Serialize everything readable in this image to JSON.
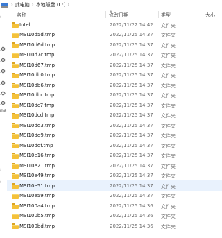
{
  "breadcrumb": {
    "items": [
      "此电脑",
      "本地磁盘 (C:)"
    ],
    "separator": "›"
  },
  "nav": {
    "fragment": "ma",
    "pins": 8
  },
  "columns": {
    "name": "名称",
    "date": "修改日期",
    "type": "类型",
    "size": "大小"
  },
  "hovered_row": 16,
  "rows": [
    {
      "name": "Intel",
      "date": "2022/11/22 14:42",
      "type": "文件夹"
    },
    {
      "name": "MSI10d5d.tmp",
      "date": "2022/11/25 14:37",
      "type": "文件夹"
    },
    {
      "name": "MSI10d6d.tmp",
      "date": "2022/11/25 14:37",
      "type": "文件夹"
    },
    {
      "name": "MSI10d7c.tmp",
      "date": "2022/11/25 14:37",
      "type": "文件夹"
    },
    {
      "name": "MSI10d67.tmp",
      "date": "2022/11/25 14:37",
      "type": "文件夹"
    },
    {
      "name": "MSI10db0.tmp",
      "date": "2022/11/25 14:37",
      "type": "文件夹"
    },
    {
      "name": "MSI10db6.tmp",
      "date": "2022/11/25 14:37",
      "type": "文件夹"
    },
    {
      "name": "MSI10dbc.tmp",
      "date": "2022/11/25 14:37",
      "type": "文件夹"
    },
    {
      "name": "MSI10dc7.tmp",
      "date": "2022/11/25 14:37",
      "type": "文件夹"
    },
    {
      "name": "MSI10dcd.tmp",
      "date": "2022/11/25 14:37",
      "type": "文件夹"
    },
    {
      "name": "MSI10dd3.tmp",
      "date": "2022/11/25 14:37",
      "type": "文件夹"
    },
    {
      "name": "MSI10dd9.tmp",
      "date": "2022/11/25 14:37",
      "type": "文件夹"
    },
    {
      "name": "MSI10ddf.tmp",
      "date": "2022/11/25 14:37",
      "type": "文件夹"
    },
    {
      "name": "MSI10e16.tmp",
      "date": "2022/11/25 14:37",
      "type": "文件夹"
    },
    {
      "name": "MSI10e21.tmp",
      "date": "2022/11/25 14:37",
      "type": "文件夹"
    },
    {
      "name": "MSI10e49.tmp",
      "date": "2022/11/25 14:37",
      "type": "文件夹"
    },
    {
      "name": "MSI10e51.tmp",
      "date": "2022/11/25 14:37",
      "type": "文件夹"
    },
    {
      "name": "MSI10e59.tmp",
      "date": "2022/11/25 14:37",
      "type": "文件夹"
    },
    {
      "name": "MSI100a4.tmp",
      "date": "2022/11/25 14:36",
      "type": "文件夹"
    },
    {
      "name": "MSI100b5.tmp",
      "date": "2022/11/25 14:36",
      "type": "文件夹"
    },
    {
      "name": "MSI100bd.tmp",
      "date": "2022/11/25 14:36",
      "type": "文件夹"
    }
  ]
}
